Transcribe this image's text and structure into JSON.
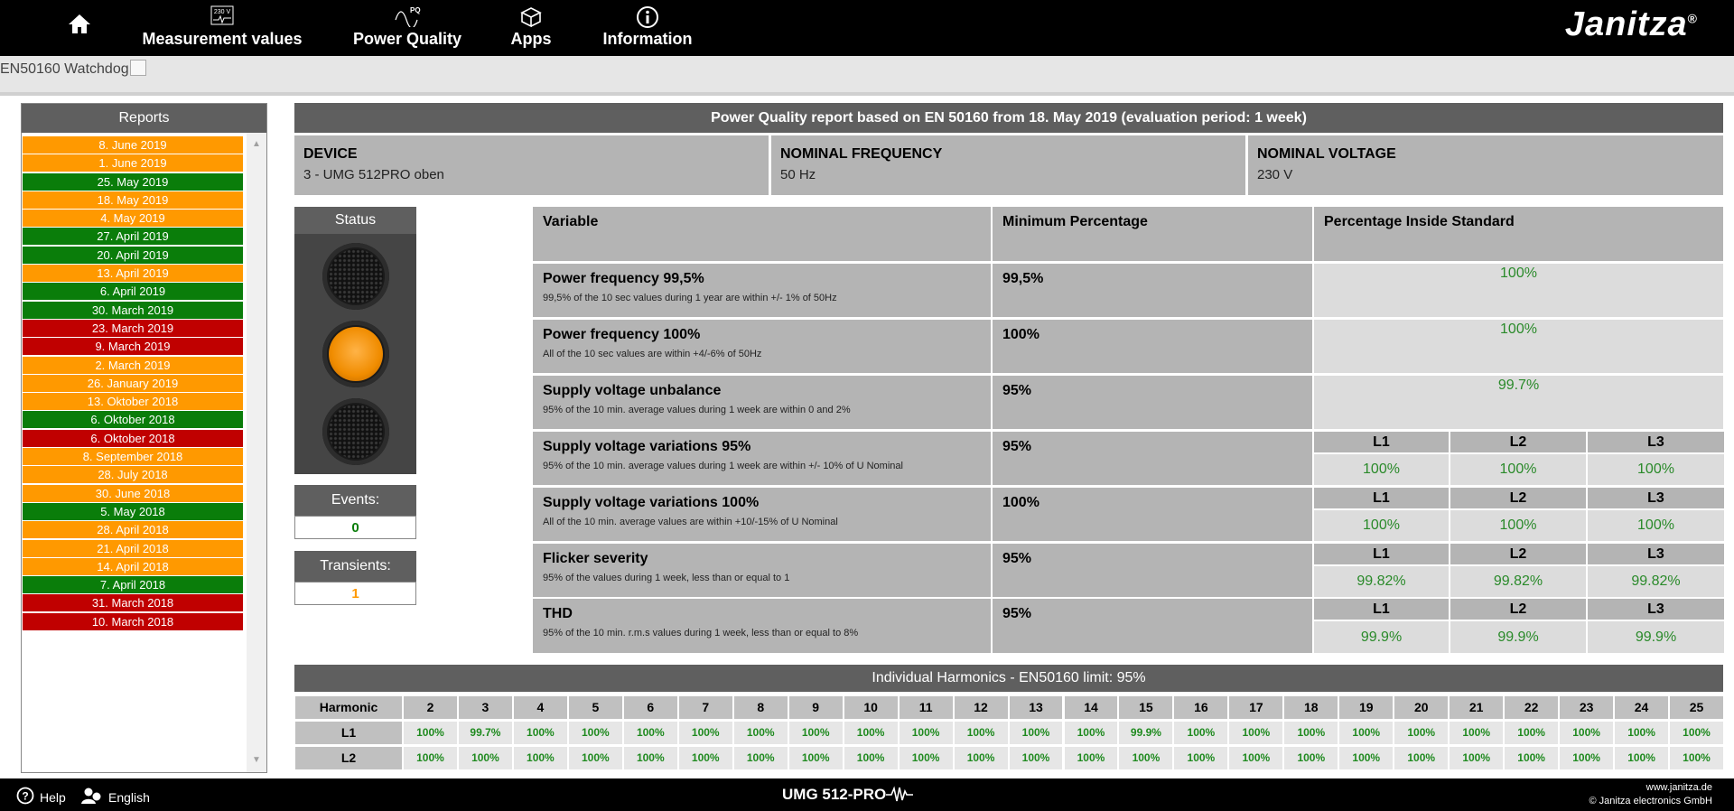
{
  "nav": {
    "items": [
      {
        "label": "",
        "icon": "home-icon"
      },
      {
        "label": "Measurement values",
        "icon": "meter-icon",
        "icon_text": "230 V"
      },
      {
        "label": "Power Quality",
        "icon": "pq-wave-icon",
        "icon_text": "PQ"
      },
      {
        "label": "Apps",
        "icon": "apps-box-icon"
      },
      {
        "label": "Information",
        "icon": "info-icon"
      }
    ],
    "brand": "Janitza",
    "brand_mark": "®"
  },
  "breadcrumb": "EN50160 Watchdog",
  "reports": {
    "title": "Reports",
    "items": [
      {
        "label": "8. June 2019",
        "status": "orange"
      },
      {
        "label": "1. June 2019",
        "status": "orange"
      },
      {
        "label": "25. May 2019",
        "status": "green"
      },
      {
        "label": "18. May 2019",
        "status": "orange"
      },
      {
        "label": "4. May 2019",
        "status": "orange"
      },
      {
        "label": "27. April 2019",
        "status": "green"
      },
      {
        "label": "20. April 2019",
        "status": "green"
      },
      {
        "label": "13. April 2019",
        "status": "orange"
      },
      {
        "label": "6. April 2019",
        "status": "green"
      },
      {
        "label": "30. March 2019",
        "status": "green"
      },
      {
        "label": "23. March 2019",
        "status": "red"
      },
      {
        "label": "9. March 2019",
        "status": "red"
      },
      {
        "label": "2. March 2019",
        "status": "orange"
      },
      {
        "label": "26. January 2019",
        "status": "orange"
      },
      {
        "label": "13. Oktober 2018",
        "status": "orange"
      },
      {
        "label": "6. Oktober 2018",
        "status": "green"
      },
      {
        "label": "6. Oktober 2018",
        "status": "red"
      },
      {
        "label": "8. September 2018",
        "status": "orange"
      },
      {
        "label": "28. July 2018",
        "status": "orange"
      },
      {
        "label": "30. June 2018",
        "status": "orange"
      },
      {
        "label": "5. May 2018",
        "status": "green"
      },
      {
        "label": "28. April 2018",
        "status": "orange"
      },
      {
        "label": "21. April 2018",
        "status": "orange"
      },
      {
        "label": "14. April 2018",
        "status": "orange"
      },
      {
        "label": "7. April 2018",
        "status": "green"
      },
      {
        "label": "31. March 2018",
        "status": "red"
      },
      {
        "label": "10. March 2018",
        "status": "red"
      }
    ]
  },
  "report": {
    "title": "Power Quality report based on EN 50160 from 18. May 2019 (evaluation period: 1 week)",
    "device_label": "DEVICE",
    "device_value": "3 - UMG 512PRO oben",
    "freq_label": "NOMINAL FREQUENCY",
    "freq_value": "50 Hz",
    "volt_label": "NOMINAL VOLTAGE",
    "volt_value": "230 V"
  },
  "status": {
    "title": "Status",
    "active_lamp": "yellow",
    "events_label": "Events:",
    "events_value": "0",
    "transients_label": "Transients:",
    "transients_value": "1"
  },
  "variables": {
    "headers": [
      "Variable",
      "Minimum Percentage",
      "Percentage Inside Standard"
    ],
    "rows": [
      {
        "name": "Power frequency 99,5%",
        "desc": "99,5% of the 10 sec values during 1 year are within +/- 1% of 50Hz",
        "min": "99,5%",
        "value": "100%"
      },
      {
        "name": "Power frequency 100%",
        "desc": "All of the 10 sec values are within +4/-6% of 50Hz",
        "min": "100%",
        "value": "100%"
      },
      {
        "name": "Supply voltage unbalance",
        "desc": "95% of the 10 min. average values during 1 week are within 0 and 2%",
        "min": "95%",
        "value": "99.7%"
      },
      {
        "name": "Supply voltage variations 95%",
        "desc": "95% of the 10 min. average values during 1 week are within +/- 10% of U Nominal",
        "min": "95%",
        "phases": [
          "L1",
          "L2",
          "L3"
        ],
        "values": [
          "100%",
          "100%",
          "100%"
        ]
      },
      {
        "name": "Supply voltage variations 100%",
        "desc": "All of the 10 min. average values are within +10/-15% of U Nominal",
        "min": "100%",
        "phases": [
          "L1",
          "L2",
          "L3"
        ],
        "values": [
          "100%",
          "100%",
          "100%"
        ]
      },
      {
        "name": "Flicker severity",
        "desc": "95% of the values during 1 week, less than or equal to 1",
        "min": "95%",
        "phases": [
          "L1",
          "L2",
          "L3"
        ],
        "values": [
          "99.82%",
          "99.82%",
          "99.82%"
        ]
      },
      {
        "name": "THD",
        "desc": "95% of the 10 min. r.m.s values during 1 week, less than or equal to 8%",
        "min": "95%",
        "phases": [
          "L1",
          "L2",
          "L3"
        ],
        "values": [
          "99.9%",
          "99.9%",
          "99.9%"
        ]
      }
    ]
  },
  "harmonics": {
    "title": "Individual Harmonics - EN50160 limit: 95%",
    "header_label": "Harmonic",
    "orders": [
      "2",
      "3",
      "4",
      "5",
      "6",
      "7",
      "8",
      "9",
      "10",
      "11",
      "12",
      "13",
      "14",
      "15",
      "16",
      "17",
      "18",
      "19",
      "20",
      "21",
      "22",
      "23",
      "24",
      "25"
    ],
    "rows": [
      {
        "label": "L1",
        "values": [
          "100%",
          "99.7%",
          "100%",
          "100%",
          "100%",
          "100%",
          "100%",
          "100%",
          "100%",
          "100%",
          "100%",
          "100%",
          "100%",
          "99.9%",
          "100%",
          "100%",
          "100%",
          "100%",
          "100%",
          "100%",
          "100%",
          "100%",
          "100%",
          "100%"
        ]
      },
      {
        "label": "L2",
        "values": [
          "100%",
          "100%",
          "100%",
          "100%",
          "100%",
          "100%",
          "100%",
          "100%",
          "100%",
          "100%",
          "100%",
          "100%",
          "100%",
          "100%",
          "100%",
          "100%",
          "100%",
          "100%",
          "100%",
          "100%",
          "100%",
          "100%",
          "100%",
          "100%"
        ]
      }
    ]
  },
  "footer": {
    "help": "Help",
    "language": "English",
    "model": "UMG 512-PRO",
    "site": "www.janitza.de",
    "copyright": "© Janitza electronics GmbH"
  },
  "colors": {
    "orange": "#ff9900",
    "green": "#0a7d0a",
    "red": "#c00000",
    "ok_text": "#2a8a2a",
    "events_color": "#0a7d0a",
    "transients_color": "#ff9900"
  }
}
